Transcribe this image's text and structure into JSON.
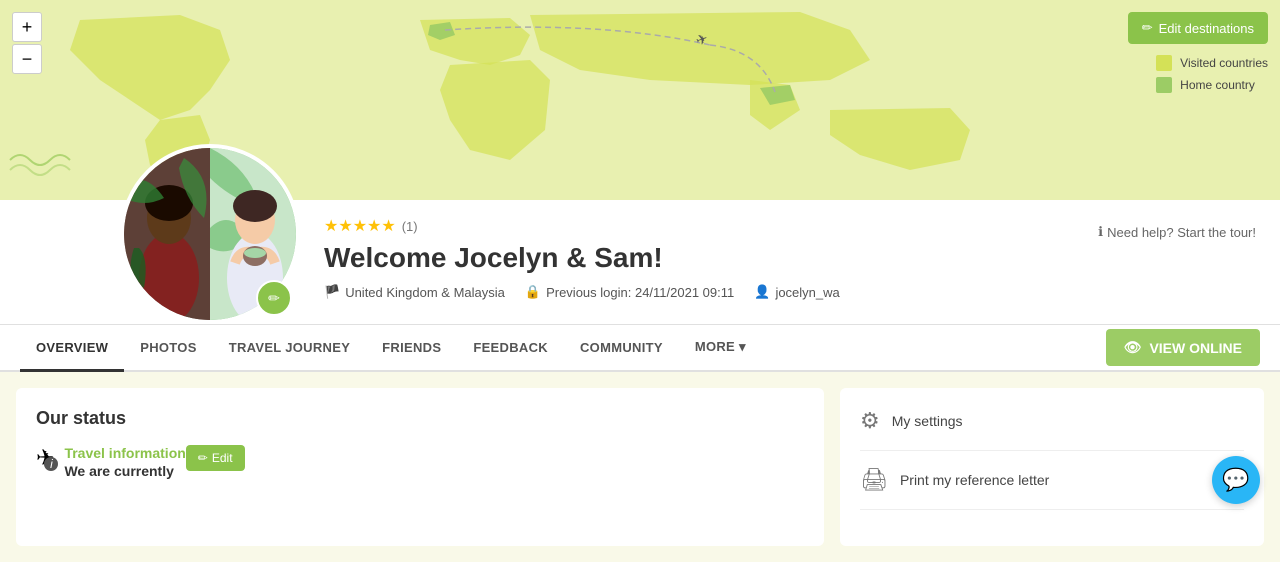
{
  "map": {
    "plus_label": "+",
    "minus_label": "−",
    "edit_btn_label": "Edit destinations",
    "legend_visited": "Visited countries",
    "legend_home": "Home country"
  },
  "profile": {
    "stars": "★★★★★",
    "review_count": "(1)",
    "welcome_title": "Welcome Jocelyn & Sam!",
    "country": "United Kingdom & Malaysia",
    "last_login_label": "Previous login: 24/11/2021 09:11",
    "username": "jocelyn_wa",
    "help_text": "Need help? Start the tour!",
    "edit_avatar_icon": "✏"
  },
  "nav": {
    "tabs": [
      {
        "id": "overview",
        "label": "OVERVIEW",
        "active": true
      },
      {
        "id": "photos",
        "label": "PHOTOS",
        "active": false
      },
      {
        "id": "travel-journey",
        "label": "TRAVEL JOURNEY",
        "active": false
      },
      {
        "id": "friends",
        "label": "FRIENDS",
        "active": false
      },
      {
        "id": "feedback",
        "label": "FEEDBACK",
        "active": false
      },
      {
        "id": "community",
        "label": "COMMUNITY",
        "active": false
      },
      {
        "id": "more",
        "label": "MORE ▾",
        "active": false
      }
    ],
    "view_online_label": "VIEW ONLINE",
    "view_online_icon": "👁"
  },
  "main_panel": {
    "title": "Our status",
    "travel_info_label": "Travel information",
    "travel_status": "We are currently",
    "edit_label": "Edit",
    "travel_icon": "✈"
  },
  "side_panel": {
    "settings_label": "My settings",
    "print_label": "Print my reference letter"
  }
}
